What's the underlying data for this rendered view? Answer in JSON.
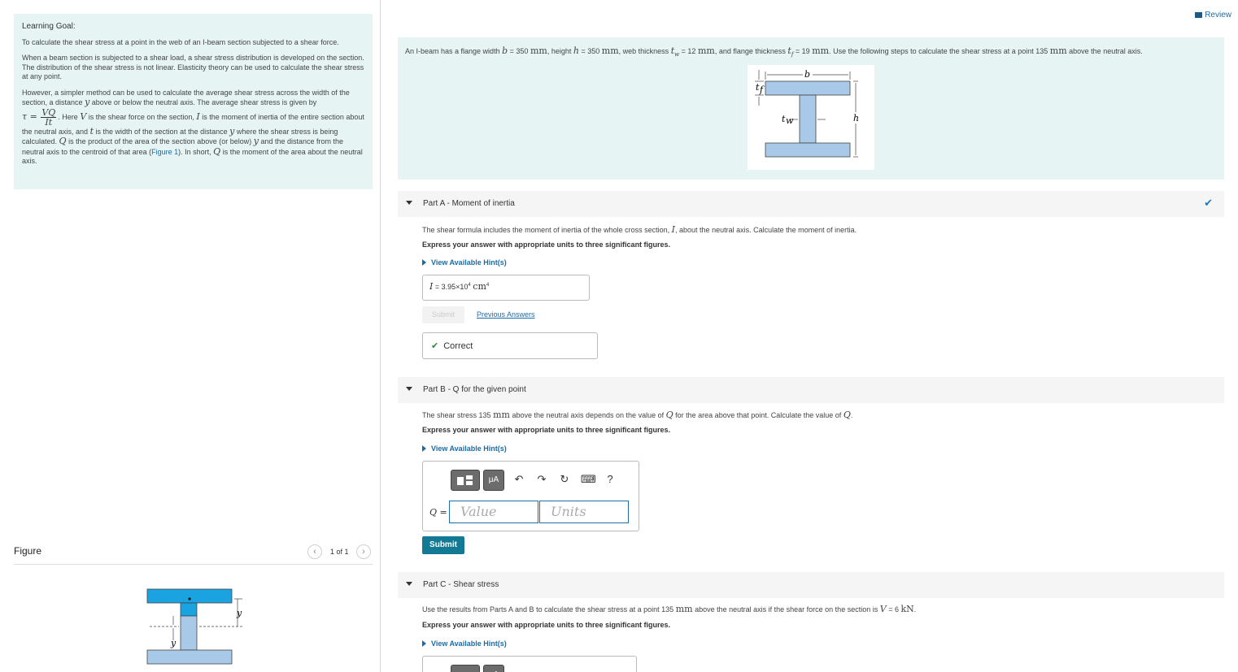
{
  "header": {
    "review_label": "Review"
  },
  "learning_goal": {
    "heading": "Learning Goal:",
    "p1": "To calculate the shear stress at a point in the web of an I-beam section subjected to a shear force.",
    "p2": "When a beam section is subjected to a shear load, a shear stress distribution is developed on the section. The distribution of the shear stress is not linear. Elasticity theory can be used to calculate the shear stress at any point.",
    "p3a": "However, a simpler method can be used to calculate the average shear stress across the width of the section, a distance",
    "p3b": "above or below the neutral axis. The average shear stress is given by",
    "p3c": ". Here",
    "p3d": "is the shear force on the section,",
    "p3e": "is the moment of inertia of the entire section about the neutral axis, and",
    "p3f": "is the width of the section at the distance",
    "p3g": "where the shear stress is being calculated.",
    "p3h": "is the product of the area of the section above (or below)",
    "p3i": "and the distance from the neutral axis to the centroid of that area (",
    "p3link": "Figure 1",
    "p3j": "). In short,",
    "p3k": "is the moment of the area about the neutral axis.",
    "sym_y": "y",
    "sym_tau": "τ =",
    "sym_VQ": "VQ",
    "sym_It": "It",
    "sym_V": "V",
    "sym_I": "I",
    "sym_t": "t",
    "sym_Q": "Q"
  },
  "figure_panel": {
    "title": "Figure",
    "prev_icon": "chevron-left-icon",
    "next_icon": "chevron-right-icon",
    "prev_glyph": "‹",
    "next_glyph": "›",
    "count": "1 of 1",
    "label_y": "y",
    "label_ybar": "y"
  },
  "problem": {
    "t1": "An I-beam has a flange width",
    "sym_b": "b",
    "t2": "= 350",
    "unit_mm": "mm",
    "t3": ", height",
    "sym_h": "h",
    "t4": "= 350",
    "t5": ", web thickness",
    "sym_tw": "t",
    "sub_w": "w",
    "t6": "= 12",
    "t7": ", and flange thickness",
    "sym_tf": "t",
    "sub_f": "f",
    "t8": "= 19",
    "t9": ". Use the following steps to calculate the shear stress at a point 135",
    "t10": "above the neutral axis.",
    "fig_b": "b",
    "fig_h": "h",
    "fig_tf": "t",
    "fig_tf_sub": "f",
    "fig_tw": "t",
    "fig_tw_sub": "w"
  },
  "partA": {
    "title": "Part A - Moment of inertia",
    "check_glyph": "✔",
    "text1": "The shear formula includes the moment of inertia of the whole cross section,",
    "sym_I": "I",
    "text2": ", about the neutral axis. Calculate the moment of inertia.",
    "express": "Express your answer with appropriate units to three significant figures.",
    "hint": "View Available Hint(s)",
    "answer_sym": "I",
    "answer_eq": " = ",
    "answer_val": "3.95×10",
    "answer_exp": "4",
    "answer_unit": "cm",
    "answer_unit_exp": "4",
    "submit": "Submit",
    "previous": "Previous Answers",
    "correct_glyph": "✔",
    "correct": "Correct"
  },
  "partB": {
    "title": "Part B - Q for the given point",
    "text1": "The shear stress 135",
    "unit_mm": "mm",
    "text2": "above the neutral axis depends on the value of",
    "sym_Q": "Q",
    "text3": "for the area above that point. Calculate the value of",
    "text4": ".",
    "express": "Express your answer with appropriate units to three significant figures.",
    "hint": "View Available Hint(s)",
    "toolbar": {
      "mu_label": "μA",
      "undo_glyph": "↶",
      "redo_glyph": "↷",
      "reset_glyph": "↻",
      "keyboard_glyph": "⌨",
      "help_glyph": "?"
    },
    "q_label": "Q =",
    "value_placeholder": "Value",
    "units_placeholder": "Units",
    "submit": "Submit"
  },
  "partC": {
    "title": "Part C - Shear stress",
    "text1": "Use the results from Parts A and B to calculate the shear stress at a point 135",
    "unit_mm": "mm",
    "text2": "above the neutral axis if the shear force on the section is",
    "sym_V": "V",
    "text3": "= 6",
    "unit_kN": "kN",
    "text4": ".",
    "express": "Express your answer with appropriate units to three significant figures.",
    "hint": "View Available Hint(s)",
    "mu_label": "μA"
  },
  "colors": {
    "panel_bg": "#e6f4f4",
    "beam_fill": "#a9c9e8",
    "beam_top_fill": "#1aa3e0",
    "link": "#1a6ca8",
    "submit_bg": "#137a96",
    "correct_check": "#2c8a3a"
  }
}
